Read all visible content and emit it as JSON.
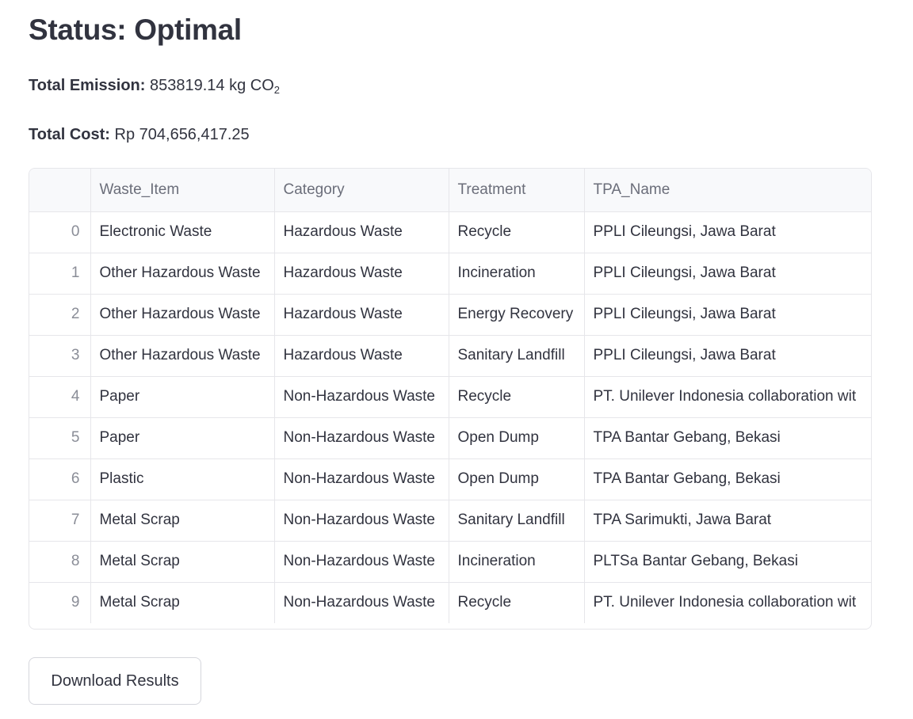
{
  "status": {
    "title": "Status: Optimal"
  },
  "metrics": {
    "emission_label": "Total Emission:",
    "emission_value": "853819.14 kg CO",
    "emission_subscript": "2",
    "cost_label": "Total Cost:",
    "cost_value": "Rp 704,656,417.25"
  },
  "table": {
    "columns": [
      "",
      "Waste_Item",
      "Category",
      "Treatment",
      "TPA_Name"
    ],
    "rows": [
      {
        "index": "0",
        "item": "Electronic Waste",
        "category": "Hazardous Waste",
        "treatment": "Recycle",
        "tpa": "PPLI Cileungsi, Jawa Barat"
      },
      {
        "index": "1",
        "item": "Other Hazardous Waste",
        "category": "Hazardous Waste",
        "treatment": "Incineration",
        "tpa": "PPLI Cileungsi, Jawa Barat"
      },
      {
        "index": "2",
        "item": "Other Hazardous Waste",
        "category": "Hazardous Waste",
        "treatment": "Energy Recovery",
        "tpa": "PPLI Cileungsi, Jawa Barat"
      },
      {
        "index": "3",
        "item": "Other Hazardous Waste",
        "category": "Hazardous Waste",
        "treatment": "Sanitary Landfill",
        "tpa": "PPLI Cileungsi, Jawa Barat"
      },
      {
        "index": "4",
        "item": "Paper",
        "category": "Non-Hazardous Waste",
        "treatment": "Recycle",
        "tpa": "PT. Unilever Indonesia collaboration wit"
      },
      {
        "index": "5",
        "item": "Paper",
        "category": "Non-Hazardous Waste",
        "treatment": "Open Dump",
        "tpa": "TPA Bantar Gebang, Bekasi"
      },
      {
        "index": "6",
        "item": "Plastic",
        "category": "Non-Hazardous Waste",
        "treatment": "Open Dump",
        "tpa": "TPA Bantar Gebang, Bekasi"
      },
      {
        "index": "7",
        "item": "Metal Scrap",
        "category": "Non-Hazardous Waste",
        "treatment": "Sanitary Landfill",
        "tpa": "TPA Sarimukti, Jawa Barat"
      },
      {
        "index": "8",
        "item": "Metal Scrap",
        "category": "Non-Hazardous Waste",
        "treatment": "Incineration",
        "tpa": "PLTSa Bantar Gebang, Bekasi"
      },
      {
        "index": "9",
        "item": "Metal Scrap",
        "category": "Non-Hazardous Waste",
        "treatment": "Recycle",
        "tpa": "PT. Unilever Indonesia collaboration wit"
      }
    ]
  },
  "actions": {
    "download_label": "Download Results"
  }
}
